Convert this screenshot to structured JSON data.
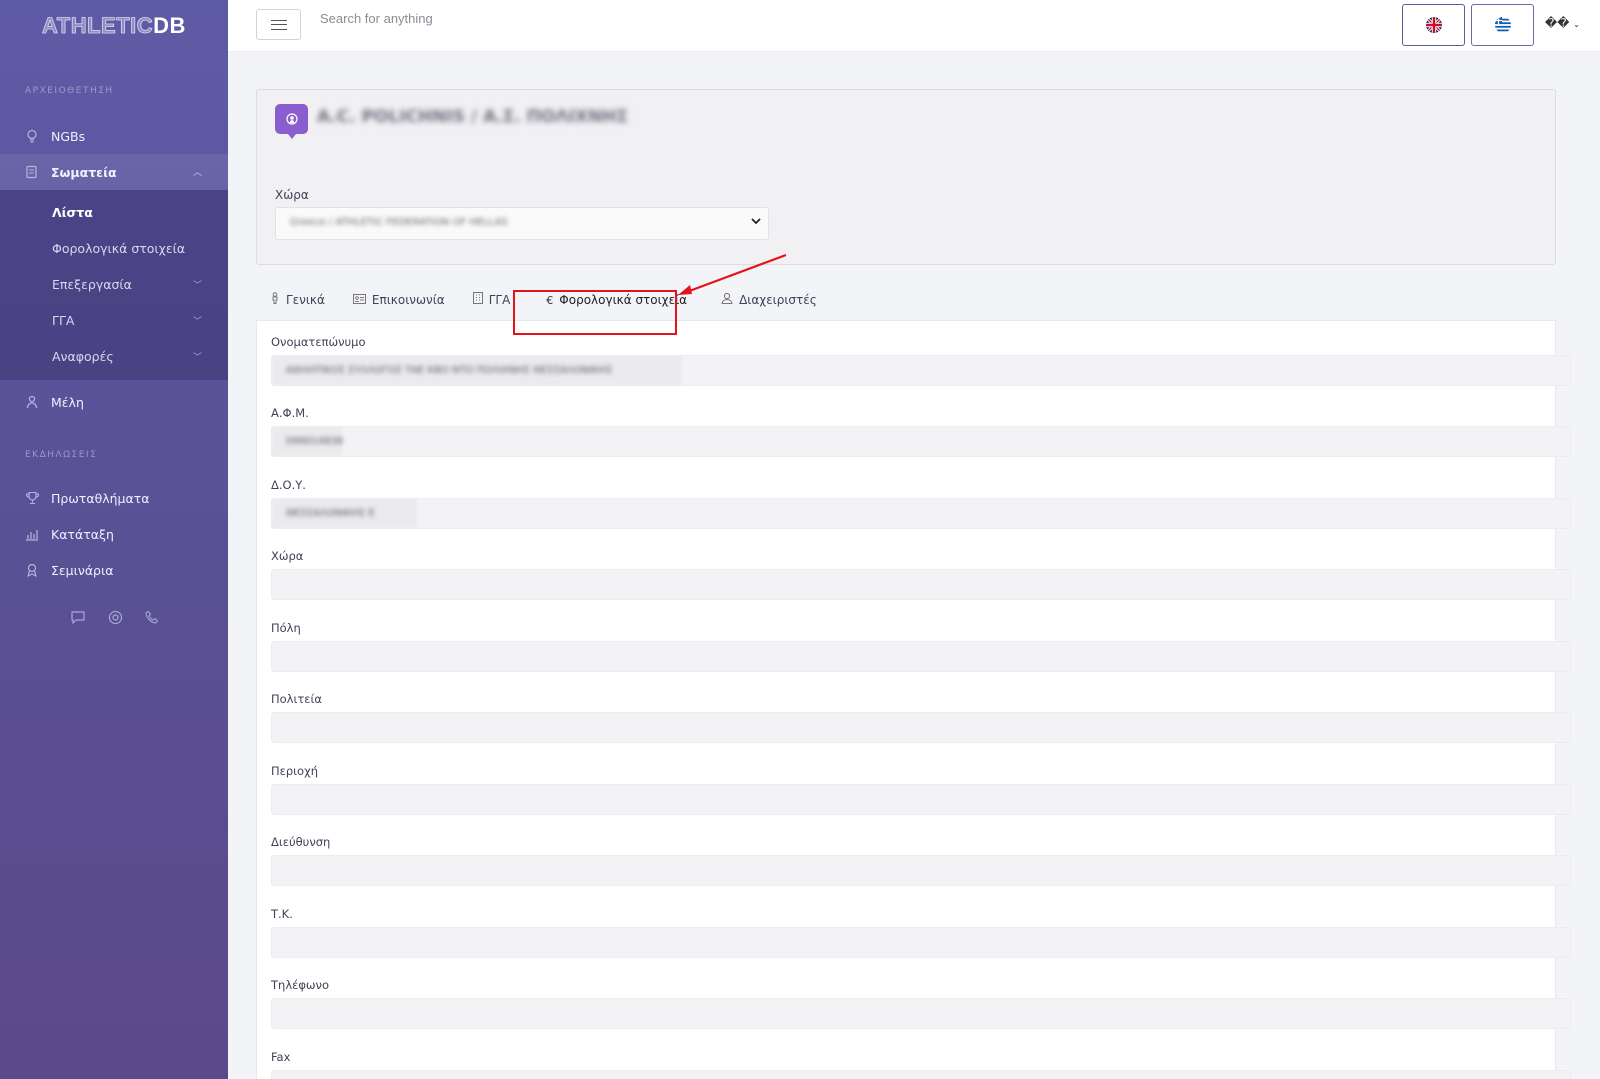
{
  "brand": {
    "part1": "ATHLETIC",
    "part2": "DB"
  },
  "sidebar": {
    "section1": "ΑΡΧΕΙΟΘΕΤΗΣΗ",
    "section2": "ΕΚΔΗΛΩΣΕΙΣ",
    "items": [
      {
        "label": "NGBs",
        "icon": "lightbulb-icon"
      },
      {
        "label": "Σωματεία",
        "icon": "document-icon"
      },
      {
        "label": "Μέλη",
        "icon": "person-icon"
      },
      {
        "label": "Πρωταθλήματα",
        "icon": "trophy-icon"
      },
      {
        "label": "Κατάταξη",
        "icon": "bar-chart-icon"
      },
      {
        "label": "Σεμινάρια",
        "icon": "award-icon"
      }
    ],
    "subitems": [
      {
        "label": "Λίστα"
      },
      {
        "label": "Φορολογικά στοιχεία"
      },
      {
        "label": "Επεξεργασία"
      },
      {
        "label": "ΓΓΑ"
      },
      {
        "label": "Αναφορές"
      }
    ]
  },
  "topbar": {
    "search_placeholder": "Search for anything",
    "user_menu": "��"
  },
  "club": {
    "name": "Α.C. POLICHNIS / Α.Σ. ΠΟΛΙΧΝΗΣ",
    "country_label": "Χώρα",
    "country_value": "Greece / ATHLETIC FEDERATION OF HELLAS"
  },
  "tabs": [
    {
      "label": "Γενικά",
      "icon": "person-icon"
    },
    {
      "label": "Επικοινωνία",
      "icon": "contact-card-icon"
    },
    {
      "label": "ΓΓΑ",
      "icon": "building-icon"
    },
    {
      "label": "Φορολογικά στοιχεία",
      "icon": "euro-icon"
    },
    {
      "label": "Διαχειριστές",
      "icon": "user-icon"
    }
  ],
  "fields": [
    {
      "label": "Ονοματεπώνυμο",
      "value": "ΑΘΛΗΤΙΚΟΣ ΣΥΛΛΟΓΟΣ ΤΑΕ ΚΒΟ ΝΤΟ ΠΟΛΙΧΝΗΣ ΘΕΣΣΑΛΟΝΙΚΗΣ"
    },
    {
      "label": "Α.Φ.Μ.",
      "value": "099014836"
    },
    {
      "label": "Δ.Ο.Υ.",
      "value": "ΘΕΣΣΑΛΟΝΙΚΗΣ Ε"
    },
    {
      "label": "Χώρα",
      "value": ""
    },
    {
      "label": "Πόλη",
      "value": ""
    },
    {
      "label": "Πολιτεία",
      "value": ""
    },
    {
      "label": "Περιοχή",
      "value": ""
    },
    {
      "label": "Διεύθυνση",
      "value": ""
    },
    {
      "label": "Τ.Κ.",
      "value": ""
    },
    {
      "label": "Τηλέφωνο",
      "value": ""
    },
    {
      "label": "Fax",
      "value": ""
    }
  ]
}
